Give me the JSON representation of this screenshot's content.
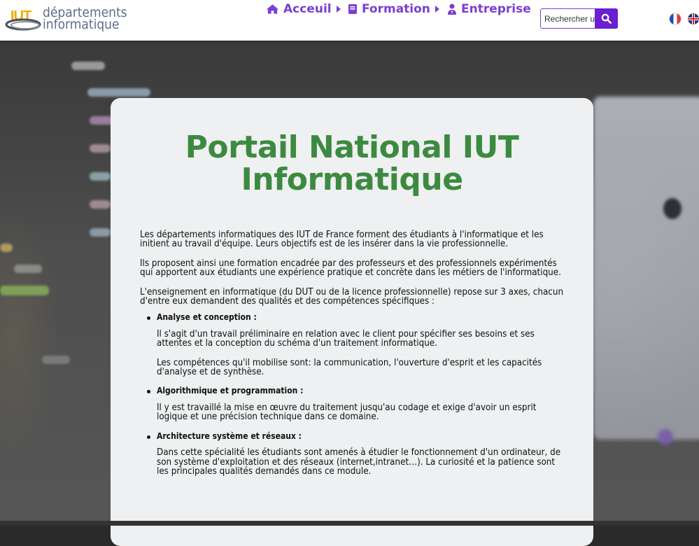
{
  "header": {
    "logo_iut": "IUT",
    "logo_line1": "départements",
    "logo_line2": "informatique",
    "nav": [
      {
        "label": "Acceuil",
        "icon": "home-icon",
        "has_submenu": true
      },
      {
        "label": "Formation",
        "icon": "book-icon",
        "has_submenu": true
      },
      {
        "label": "Entreprise",
        "icon": "user-tie-icon",
        "has_submenu": false
      }
    ],
    "search": {
      "placeholder": "Rechercher un",
      "icon": "search-icon"
    },
    "languages": [
      {
        "code": "fr",
        "icon": "flag-fr-icon"
      },
      {
        "code": "en",
        "icon": "flag-uk-icon"
      }
    ],
    "accent_color": "#7b3fd1"
  },
  "main": {
    "title": "Portail National IUT Informatique",
    "title_color": "#3c8a40",
    "paragraphs": [
      "Les départements informatiques des IUT de France forment des étudiants à l'informatique et les initient au travail d'équipe. Leurs objectifs est de les insérer dans la vie professionnelle.",
      "Ils proposent ainsi une formation encadrée par des professeurs et des professionnels expérimentés qui apportent aux étudiants une expérience pratique et concrète dans les métiers de l'informatique.",
      "L'enseignement en informatique (du DUT ou de la licence professionnelle) repose sur 3 axes, chacun d'entre eux demandent des qualités et des compétences spécifiques :"
    ],
    "axes": [
      {
        "title": "Analyse et conception :",
        "texts": [
          "Il s'agit d'un travail préliminaire en relation avec le client pour spécifier ses besoins et ses attentes et la conception du schéma d'un traitement informatique.",
          "Les compétences qu'il mobilise sont: la communication, l'ouverture d'esprit et les capacités d'analyse et de synthèse."
        ]
      },
      {
        "title": "Algorithmique et programmation :",
        "texts": [
          "Il y est travaillé la mise en œuvre du traitement jusqu'au codage et exige d'avoir un esprit logique et une précision technique dans ce domaine."
        ]
      },
      {
        "title": "Architecture système et réseaux :",
        "texts": [
          "Dans cette spécialité les étudiants sont amenés à étudier le fonctionnement d'un ordinateur, de son système d'exploitation et des réseaux (internet,intranet…). La curiosité et la patience sont les principales qualités demandés dans ce module."
        ]
      }
    ]
  }
}
